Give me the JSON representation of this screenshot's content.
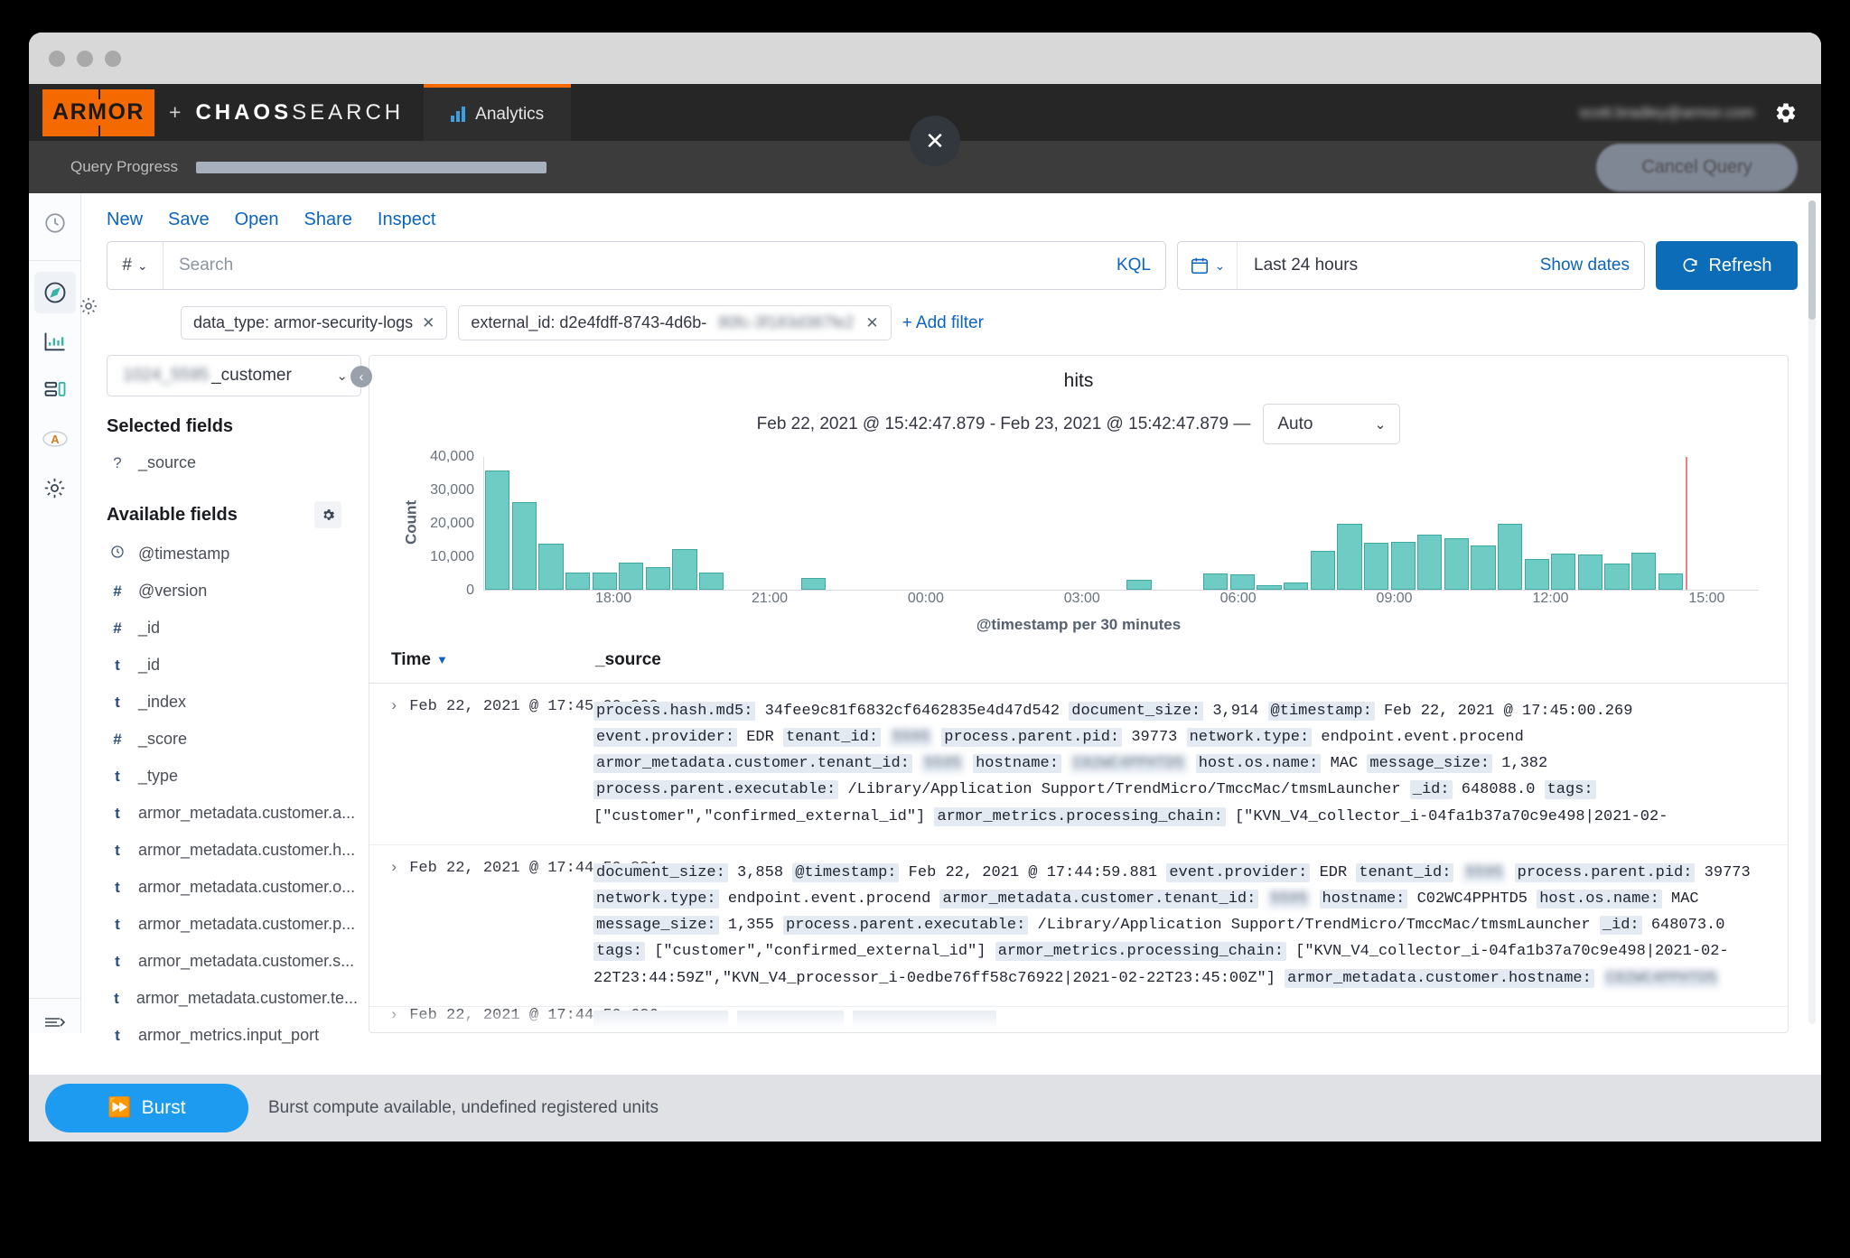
{
  "window": {
    "traffic_lights": [
      "close",
      "minimize",
      "maximize"
    ]
  },
  "header": {
    "armor_logo": "ARMOR",
    "plus": "+",
    "chaos_bold": "CHAOS",
    "chaos_light": "SEARCH",
    "nav_tab": "Analytics",
    "user_email": "scott.bradley@armor.com",
    "gear_icon": "gear-icon"
  },
  "query_progress": {
    "label": "Query Progress",
    "cancel_label": "Cancel Query",
    "progress_percent": 100,
    "close_icon": "close-icon"
  },
  "rail": {
    "items": [
      {
        "name": "recently-viewed",
        "icon": "clock-icon"
      },
      {
        "name": "discover",
        "icon": "compass-icon",
        "active": true
      },
      {
        "name": "visualize",
        "icon": "chart-icon"
      },
      {
        "name": "dashboard",
        "icon": "dashboard-icon"
      },
      {
        "name": "apm",
        "icon": "letter-a-icon"
      },
      {
        "name": "management",
        "icon": "gear-icon"
      }
    ],
    "collapse_icon": "collapse-nav-icon"
  },
  "toolbar": {
    "new": "New",
    "save": "Save",
    "open": "Open",
    "share": "Share",
    "inspect": "Inspect"
  },
  "search": {
    "prefix_icon": "hash-icon",
    "placeholder": "Search",
    "value": "",
    "language_badge": "KQL",
    "calendar_icon": "calendar-icon",
    "date_range": "Last 24 hours",
    "show_dates": "Show dates",
    "refresh_label": "Refresh",
    "refresh_icon": "refresh-icon",
    "refresh_color": "#0d6cb8"
  },
  "filters": {
    "gear_icon": "filter-settings-icon",
    "pills": [
      {
        "label": "data_type: armor-security-logs",
        "redacted": ""
      },
      {
        "label": "external_id: d2e4fdff-8743-4d6b-",
        "redacted": "80fc-3f183d387fe2"
      }
    ],
    "add_filter": "+ Add filter"
  },
  "sidebar": {
    "index_pattern_prefix": "1024_5595",
    "index_pattern_suffix": "_customer",
    "selected_fields_title": "Selected fields",
    "selected_fields": [
      {
        "type": "?",
        "name": "_source"
      }
    ],
    "available_fields_title": "Available fields",
    "available_gear_icon": "field-settings-icon",
    "available_fields": [
      {
        "type": "clock",
        "name": "@timestamp"
      },
      {
        "type": "#",
        "name": "@version"
      },
      {
        "type": "#",
        "name": "_id"
      },
      {
        "type": "t",
        "name": "_id"
      },
      {
        "type": "t",
        "name": "_index"
      },
      {
        "type": "#",
        "name": "_score"
      },
      {
        "type": "t",
        "name": "_type"
      },
      {
        "type": "t",
        "name": "armor_metadata.customer.a..."
      },
      {
        "type": "t",
        "name": "armor_metadata.customer.h..."
      },
      {
        "type": "t",
        "name": "armor_metadata.customer.o..."
      },
      {
        "type": "t",
        "name": "armor_metadata.customer.p..."
      },
      {
        "type": "t",
        "name": "armor_metadata.customer.s..."
      },
      {
        "type": "t",
        "name": "armor_metadata.customer.te..."
      },
      {
        "type": "t",
        "name": "armor_metrics.input_port"
      }
    ]
  },
  "chart_data": {
    "type": "bar",
    "title": "hits",
    "subtitle": "Feb 22, 2021 @ 15:42:47.879 - Feb 23, 2021 @ 15:42:47.879 —",
    "interval_label": "Auto",
    "xlabel": "@timestamp per 30 minutes",
    "ylabel": "Count",
    "ylim": [
      0,
      40000
    ],
    "yticks": [
      0,
      10000,
      20000,
      30000,
      40000
    ],
    "ytick_labels": [
      "0",
      "10,000",
      "20,000",
      "30,000",
      "40,000"
    ],
    "xtick_labels": [
      "18:00",
      "21:00",
      "00:00",
      "03:00",
      "06:00",
      "09:00",
      "12:00",
      "15:00"
    ],
    "grid": false,
    "bar_color": "#6fccc4",
    "bar_border": "#3fa8a0",
    "now_marker_color": "#f08080",
    "categories": [
      "15:30",
      "16:00",
      "16:30",
      "17:00",
      "17:30",
      "18:00",
      "18:30",
      "19:00",
      "19:30",
      "20:00",
      "20:30",
      "21:00",
      "21:30",
      "22:00",
      "22:30",
      "23:00",
      "23:30",
      "00:00",
      "00:30",
      "01:00",
      "01:30",
      "02:00",
      "02:30",
      "03:00",
      "03:30",
      "04:00",
      "04:30",
      "05:00",
      "05:30",
      "06:00",
      "06:30",
      "07:00",
      "07:30",
      "08:00",
      "08:30",
      "09:00",
      "09:30",
      "10:00",
      "10:30",
      "11:00",
      "11:30",
      "12:00",
      "12:30",
      "13:00",
      "13:30",
      "14:00",
      "14:30",
      "15:00",
      "15:30"
    ],
    "values": [
      36000,
      26400,
      13700,
      5000,
      5000,
      8100,
      6600,
      12200,
      5100,
      0,
      0,
      0,
      3400,
      0,
      0,
      0,
      0,
      0,
      0,
      0,
      0,
      0,
      0,
      0,
      0,
      2800,
      0,
      0,
      4700,
      4500,
      1300,
      2200,
      11600,
      19900,
      14100,
      14400,
      16600,
      15400,
      13200,
      19700,
      9100,
      10800,
      10400,
      7900,
      11000,
      4900,
      0,
      0,
      0
    ]
  },
  "doc_table": {
    "col_time": "Time",
    "col_source": "_source",
    "sort_icon": "sort-desc-icon",
    "rows": [
      {
        "time": "Feb 22, 2021 @ 17:45:00.269",
        "expand_icon": "expand-row-icon",
        "fields": [
          {
            "k": "process.hash.md5:",
            "v": "34fee9c81f6832cf6462835e4d47d542"
          },
          {
            "k": "document_size:",
            "v": "3,914"
          },
          {
            "k": "@timestamp:",
            "v": "Feb 22, 2021 @ 17:45:00.269"
          },
          {
            "k": "event.provider:",
            "v": "EDR"
          },
          {
            "k": "tenant_id:",
            "v": "5595",
            "redacted": true
          },
          {
            "k": "process.parent.pid:",
            "v": "39773"
          },
          {
            "k": "network.type:",
            "v": "endpoint.event.procend"
          },
          {
            "k": "armor_metadata.customer.tenant_id:",
            "v": "5595",
            "redacted": true
          },
          {
            "k": "hostname:",
            "v": "C02WC4PPHTD5",
            "redacted": true
          },
          {
            "k": "host.os.name:",
            "v": "MAC"
          },
          {
            "k": "message_size:",
            "v": "1,382"
          },
          {
            "k": "process.parent.executable:",
            "v": "/Library/Application Support/TrendMicro/TmccMac/tmsmLauncher"
          },
          {
            "k": "_id:",
            "v": "648088.0"
          },
          {
            "k": "tags:",
            "v": "[\"customer\",\"confirmed_external_id\"]"
          },
          {
            "k": "armor_metrics.processing_chain:",
            "v": "[\"KVN_V4_collector_i-04fa1b37a70c9e498|2021-02-"
          }
        ]
      },
      {
        "time": "Feb 22, 2021 @ 17:44:59.881",
        "expand_icon": "expand-row-icon",
        "fields": [
          {
            "k": "document_size:",
            "v": "3,858"
          },
          {
            "k": "@timestamp:",
            "v": "Feb 22, 2021 @ 17:44:59.881"
          },
          {
            "k": "event.provider:",
            "v": "EDR"
          },
          {
            "k": "tenant_id:",
            "v": "5595",
            "redacted": true
          },
          {
            "k": "process.parent.pid:",
            "v": "39773"
          },
          {
            "k": "network.type:",
            "v": "endpoint.event.procend"
          },
          {
            "k": "armor_metadata.customer.tenant_id:",
            "v": "5595",
            "redacted": true
          },
          {
            "k": "hostname:",
            "v": "C02WC4PPHTD5"
          },
          {
            "k": "host.os.name:",
            "v": "MAC"
          },
          {
            "k": "message_size:",
            "v": "1,355"
          },
          {
            "k": "process.parent.executable:",
            "v": "/Library/Application Support/TrendMicro/TmccMac/tmsmLauncher"
          },
          {
            "k": "_id:",
            "v": "648073.0"
          },
          {
            "k": "tags:",
            "v": "[\"customer\",\"confirmed_external_id\"]"
          },
          {
            "k": "armor_metrics.processing_chain:",
            "v": "[\"KVN_V4_collector_i-04fa1b37a70c9e498|2021-02-22T23:44:59Z\",\"KVN_V4_processor_i-0edbe76ff58c76922|2021-02-22T23:45:00Z\"]"
          },
          {
            "k": "armor_metadata.customer.hostname:",
            "v": "C02WC4PPHTD5",
            "redacted": true
          }
        ]
      },
      {
        "time": "Feb 22, 2021 @ 17:44:59.626",
        "expand_icon": "expand-row-icon",
        "fields": []
      }
    ]
  },
  "footer": {
    "burst_label": "Burst",
    "burst_icon": "fast-forward-icon",
    "burst_note": "Burst compute available, undefined registered units",
    "burst_color": "#1d9bf0"
  }
}
